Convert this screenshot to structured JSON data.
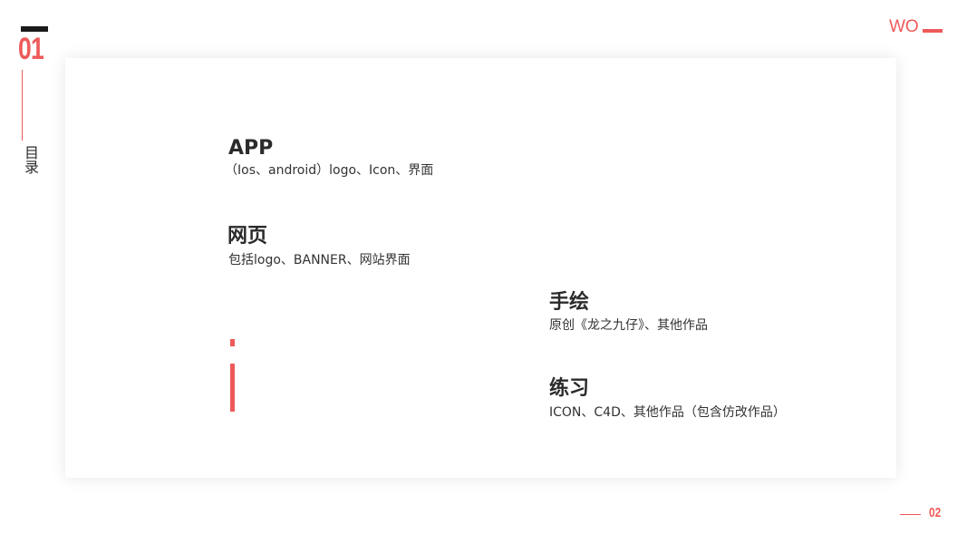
{
  "header": {
    "section_number": "01",
    "section_title": "目录",
    "brand": "WO"
  },
  "menu": [
    {
      "title": "APP",
      "desc": "（Ios、android）logo、Icon、界面"
    },
    {
      "title": "网页",
      "desc": "包括logo、BANNER、网站界面"
    },
    {
      "title": "手绘",
      "desc": "原创《龙之九仔》、其他作品"
    },
    {
      "title": "练习",
      "desc": "ICON、C4D、其他作品（包含仿改作品）"
    }
  ],
  "footer": {
    "page_number": "02"
  },
  "colors": {
    "accent": "#ee5a5a",
    "text": "#2b2b2b",
    "dark_bar": "#1a1a1a"
  }
}
